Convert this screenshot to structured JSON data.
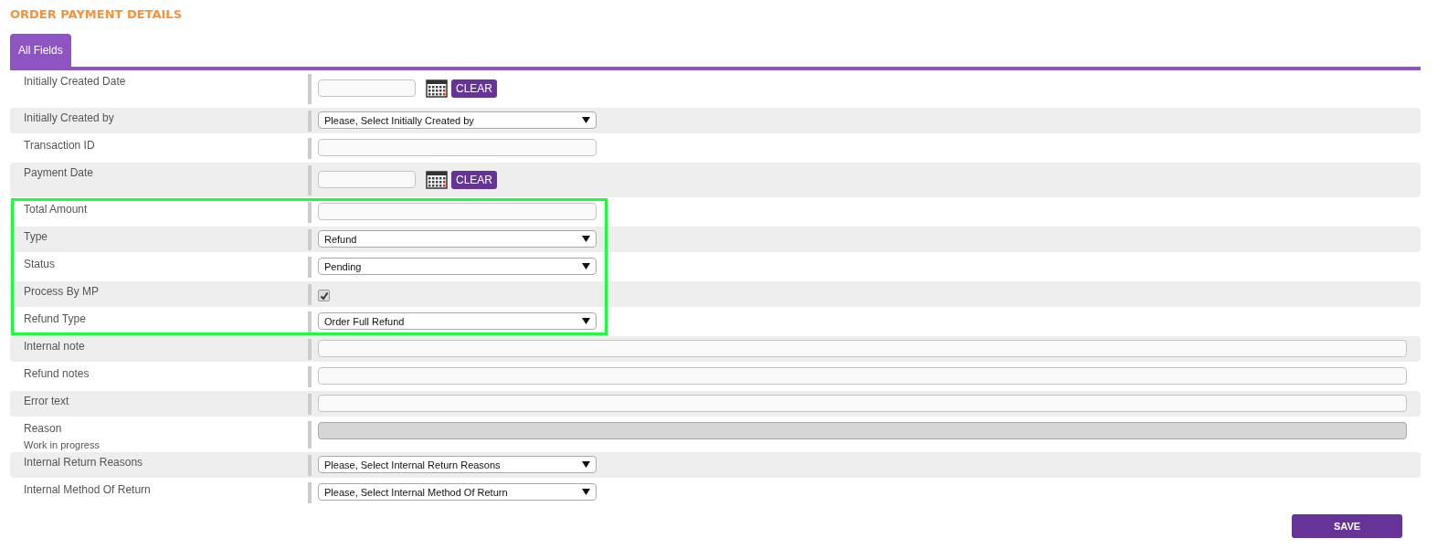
{
  "title": "ORDER PAYMENT DETAILS",
  "tabs": [
    {
      "label": "All Fields",
      "selected": true
    }
  ],
  "fields": [
    {
      "label": "Initially Created Date",
      "kind": "date",
      "clear_label": "CLEAR",
      "highlighted": false
    },
    {
      "label": "Initially Created by",
      "kind": "select",
      "value": "Please, Select Initially Created by",
      "highlighted": false
    },
    {
      "label": "Transaction ID",
      "kind": "text",
      "highlighted": false
    },
    {
      "label": "Payment Date",
      "kind": "date",
      "clear_label": "CLEAR",
      "highlighted": false
    },
    {
      "label": "Total Amount",
      "kind": "text",
      "highlighted": true
    },
    {
      "label": "Type",
      "kind": "select",
      "value": "Refund",
      "highlighted": true
    },
    {
      "label": "Status",
      "kind": "select",
      "value": "Pending",
      "highlighted": true
    },
    {
      "label": "Process By MP",
      "kind": "checkbox",
      "checked": true,
      "highlighted": true
    },
    {
      "label": "Refund Type",
      "kind": "select",
      "value": "Order Full Refund",
      "highlighted": true
    },
    {
      "label": "Internal note",
      "kind": "long_text",
      "disabled": false,
      "highlighted": false
    },
    {
      "label": "Refund notes",
      "kind": "long_text",
      "disabled": false,
      "highlighted": false
    },
    {
      "label": "Error text",
      "kind": "long_text",
      "disabled": false,
      "highlighted": false
    },
    {
      "label": "Reason",
      "note": "Work in progress",
      "kind": "long_text",
      "disabled": true,
      "highlighted": false
    },
    {
      "label": "Internal Return Reasons",
      "kind": "select",
      "value": "Please, Select Internal Return Reasons",
      "highlighted": false
    },
    {
      "label": "Internal Method Of Return",
      "kind": "select",
      "value": "Please, Select Internal Method Of Return",
      "highlighted": false
    }
  ],
  "save_button": "SAVE"
}
